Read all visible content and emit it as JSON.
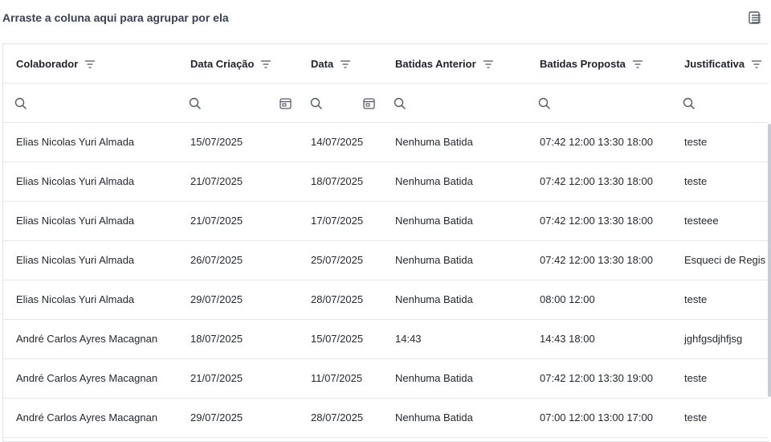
{
  "group_panel": {
    "text": "Arraste a coluna aqui para agrupar por ela"
  },
  "columns": [
    {
      "label": "Colaborador"
    },
    {
      "label": "Data Criação"
    },
    {
      "label": "Data"
    },
    {
      "label": "Batidas Anterior"
    },
    {
      "label": "Batidas Proposta"
    },
    {
      "label": "Justificativa"
    }
  ],
  "rows": [
    {
      "colaborador": "Elias Nicolas Yuri Almada",
      "data_criacao": "15/07/2025",
      "data": "14/07/2025",
      "batidas_anterior": "Nenhuma Batida",
      "batidas_proposta": "07:42 12:00 13:30 18:00",
      "justificativa": "teste"
    },
    {
      "colaborador": "Elias Nicolas Yuri Almada",
      "data_criacao": "21/07/2025",
      "data": "18/07/2025",
      "batidas_anterior": "Nenhuma Batida",
      "batidas_proposta": "07:42 12:00 13:30 18:00",
      "justificativa": "teste"
    },
    {
      "colaborador": "Elias Nicolas Yuri Almada",
      "data_criacao": "21/07/2025",
      "data": "17/07/2025",
      "batidas_anterior": "Nenhuma Batida",
      "batidas_proposta": "07:42 12:00 13:30 18:00",
      "justificativa": "testeee"
    },
    {
      "colaborador": "Elias Nicolas Yuri Almada",
      "data_criacao": "26/07/2025",
      "data": "25/07/2025",
      "batidas_anterior": "Nenhuma Batida",
      "batidas_proposta": "07:42 12:00 13:30 18:00",
      "justificativa": "Esqueci de Regis"
    },
    {
      "colaborador": "Elias Nicolas Yuri Almada",
      "data_criacao": "29/07/2025",
      "data": "28/07/2025",
      "batidas_anterior": "Nenhuma Batida",
      "batidas_proposta": "08:00 12:00",
      "justificativa": "teste"
    },
    {
      "colaborador": "André Carlos Ayres Macagnan",
      "data_criacao": "18/07/2025",
      "data": "15/07/2025",
      "batidas_anterior": "14:43",
      "batidas_proposta": "14:43 18:00",
      "justificativa": "jghfgsdjhfjsg"
    },
    {
      "colaborador": "André Carlos Ayres Macagnan",
      "data_criacao": "21/07/2025",
      "data": "11/07/2025",
      "batidas_anterior": "Nenhuma Batida",
      "batidas_proposta": "07:42 12:00 13:30 19:00",
      "justificativa": "teste"
    },
    {
      "colaborador": "André Carlos Ayres Macagnan",
      "data_criacao": "29/07/2025",
      "data": "28/07/2025",
      "batidas_anterior": "Nenhuma Batida",
      "batidas_proposta": "07:00 12:00 13:00 17:00",
      "justificativa": "teste"
    }
  ],
  "icons": {
    "column_chooser": "column-chooser-icon",
    "filter_menu": "filter-lines-icon",
    "search": "search-icon",
    "calendar": "calendar-icon"
  },
  "colors": {
    "border": "#e1e3e8",
    "text": "#1f2328",
    "icon": "#555b66"
  }
}
